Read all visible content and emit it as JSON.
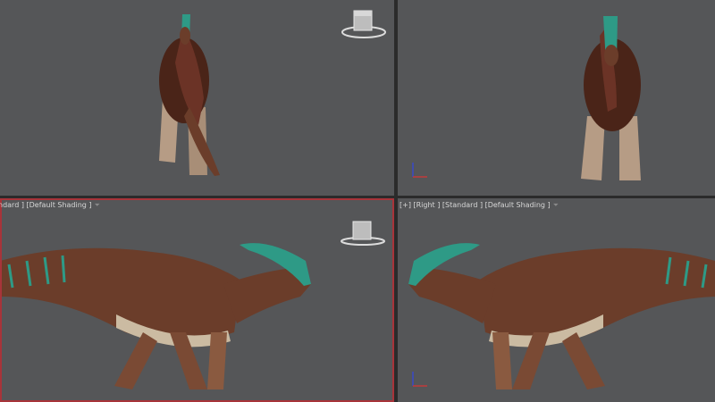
{
  "viewports": {
    "top_left": {
      "label": "",
      "active": false
    },
    "top_right": {
      "label": "",
      "active": false
    },
    "bottom_left": {
      "label": "ndard ] [Default Shading ]",
      "filter_icon": "funnel-icon",
      "active": true
    },
    "bottom_right": {
      "label": "[+] [Right ] [Standard ] [Default Shading ]",
      "filter_icon": "funnel-icon",
      "active": false
    }
  },
  "colors": {
    "viewport_bg": "#555658",
    "divider": "#2b2b2b",
    "active_border": "#a8343a",
    "skin": "#6b3d2a",
    "crest": "#2e9a86",
    "belly": "#cbbba2"
  },
  "icons": [
    "viewcube-icon",
    "axis-tripod-icon",
    "funnel-icon"
  ]
}
